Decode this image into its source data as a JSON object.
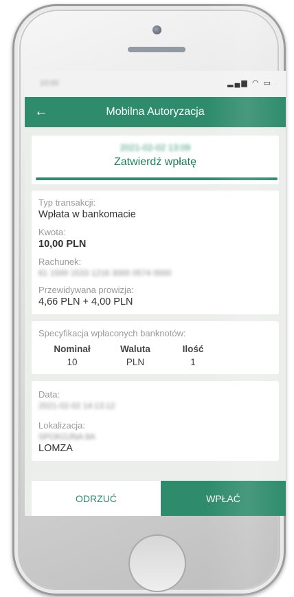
{
  "status_bar": {
    "time": "10:00",
    "icons": "▂▄▆ ◠ ▭"
  },
  "header": {
    "back_icon": "←",
    "title": "Mobilna Autoryzacja"
  },
  "auth": {
    "date": "2021-02-02 13:09",
    "title": "Zatwierdź wpłatę"
  },
  "details": {
    "type_label": "Typ transakcji:",
    "type_value": "Wpłata w bankomacie",
    "amount_label": "Kwota:",
    "amount_value": "10,00 PLN",
    "account_label": "Rachunek:",
    "account_value": "61 1500 1533 1216 3000 0574 0000",
    "fee_label": "Przewidywana prowizja:",
    "fee_value": "4,66 PLN + 4,00 PLN"
  },
  "spec": {
    "title": "Specyfikacja wpłaconych banknotów:",
    "headers": [
      "Nominał",
      "Waluta",
      "Ilość"
    ],
    "rows": [
      [
        "10",
        "PLN",
        "1"
      ]
    ]
  },
  "location": {
    "date_label": "Data:",
    "date_value": "2021-02-02 14:13:12",
    "loc_label": "Lokalizacja:",
    "loc_value_blurred": "SPOKOJNA 8A",
    "loc_city": "LOMZA"
  },
  "buttons": {
    "reject": "ODRZUĆ",
    "accept": "WPŁAĆ"
  },
  "colors": {
    "brand_green": "#2e8b6c"
  }
}
